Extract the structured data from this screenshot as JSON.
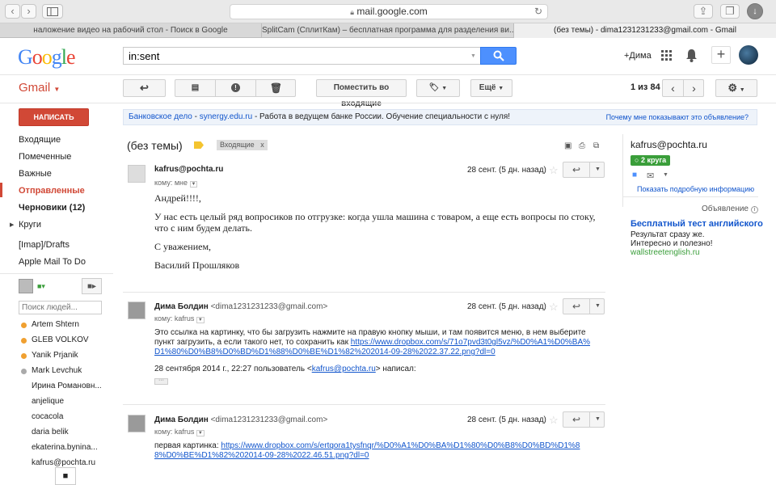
{
  "browser": {
    "url": "mail.google.com",
    "tabs": [
      {
        "label": "наложение видео на рабочий стол - Поиск в Google"
      },
      {
        "label": "SplitCam (СплитКам) – бесплатная программа для разделения ви..."
      },
      {
        "label": "(без темы) - dima1231231233@gmail.com - Gmail"
      }
    ]
  },
  "header": {
    "logo": "Google",
    "search_value": "in:sent",
    "user_link": "+Дима",
    "gmail_label": "Gmail"
  },
  "toolbar": {
    "move_inbox": "Поместить во входящие",
    "more": "Ещё",
    "pagination": "1 из 84"
  },
  "sidebar": {
    "compose": "НАПИСАТЬ",
    "items": [
      {
        "label": "Входящие"
      },
      {
        "label": "Помеченные"
      },
      {
        "label": "Важные"
      },
      {
        "label": "Отправленные"
      },
      {
        "label": "Черновики (12)"
      },
      {
        "label": "Круги"
      },
      {
        "label": "[Imap]/Drafts"
      },
      {
        "label": "Apple Mail To Do"
      }
    ],
    "people_search_placeholder": "Поиск людей...",
    "contacts": [
      {
        "name": "Artem Shtern",
        "color": "#f0a030"
      },
      {
        "name": "GLEB VOLKOV",
        "color": "#f0a030"
      },
      {
        "name": "Yanik Prjanik",
        "color": "#f0a030"
      },
      {
        "name": "Mark Levchuk",
        "color": "#aaaaaa"
      },
      {
        "name": "Ирина Романовн..."
      },
      {
        "name": "anjelique"
      },
      {
        "name": "cocacola"
      },
      {
        "name": "daria belik"
      },
      {
        "name": "ekaterina.bynina..."
      },
      {
        "name": "kafrus@pochta.ru"
      }
    ]
  },
  "ad": {
    "title": "Банковское дело",
    "site": "synergy.edu.ru",
    "text": "- Работа в ведущем банке России. Обучение специальности с нуля!",
    "why": "Почему мне показывают это объявление?"
  },
  "thread": {
    "subject": "(без темы)",
    "label": "Входящие",
    "label_close": "x"
  },
  "messages": [
    {
      "sender": "kafrus@pochta.ru",
      "email": "",
      "date": "28 сент. (5 дн. назад)",
      "to": "кому: мне",
      "lines": [
        "Андрей!!!!,",
        "У нас есть целый ряд вопросиков по отгрузке: когда ушла машина с товаром, а еще есть вопросы по стоку, что с ним будем делать.",
        "С уважением,",
        "Василий Прошляков"
      ]
    },
    {
      "sender": "Дима Болдин",
      "email": "<dima1231231233@gmail.com>",
      "date": "28 сент. (5 дн. назад)",
      "to": "кому: kafrus",
      "text": "Это ссылка на картинку, что бы загрузить нажмите на правую кнопку мыши, и там появится меню, в нем выберите пункт загрузить, а если такого нет, то сохранить как",
      "link": "https://www.dropbox.com/s/71o7pvd3t0gl5vz/%D0%A1%D0%BA%D1%80%D0%B8%D0%BD%D1%88%D0%BE%D1%82%202014-09-28%2022.37.22.png?dl=0",
      "quote_pre": "28 сентября 2014 г., 22:27 пользователь <",
      "quote_link": "kafrus@pochta.ru",
      "quote_post": "> написал:"
    },
    {
      "sender": "Дима Болдин",
      "email": "<dima1231231233@gmail.com>",
      "date": "28 сент. (5 дн. назад)",
      "to": "кому: kafrus",
      "text": "первая картинка:",
      "link": "https://www.dropbox.com/s/ertqora1tysfnqr/%D0%A1%D0%BA%D1%80%D0%B8%D0%BD%D1%88%D0%BE%D1%82%202014-09-28%2022.46.51.png?dl=0"
    }
  ],
  "contact_panel": {
    "name": "kafrus@pochta.ru",
    "circles": "2 круга",
    "details_link": "Показать подробную информацию",
    "ad_label": "Объявление",
    "ad_title": "Бесплатный тест английского",
    "ad_line1": "Результат сразу же.",
    "ad_line2": "Интересно и полезно!",
    "ad_site": "wallstreetenglish.ru"
  },
  "colors": {
    "accent": "#4d90fe",
    "compose": "#d14836",
    "sent_active": "#d14836",
    "circles": "#3a9e3a"
  }
}
